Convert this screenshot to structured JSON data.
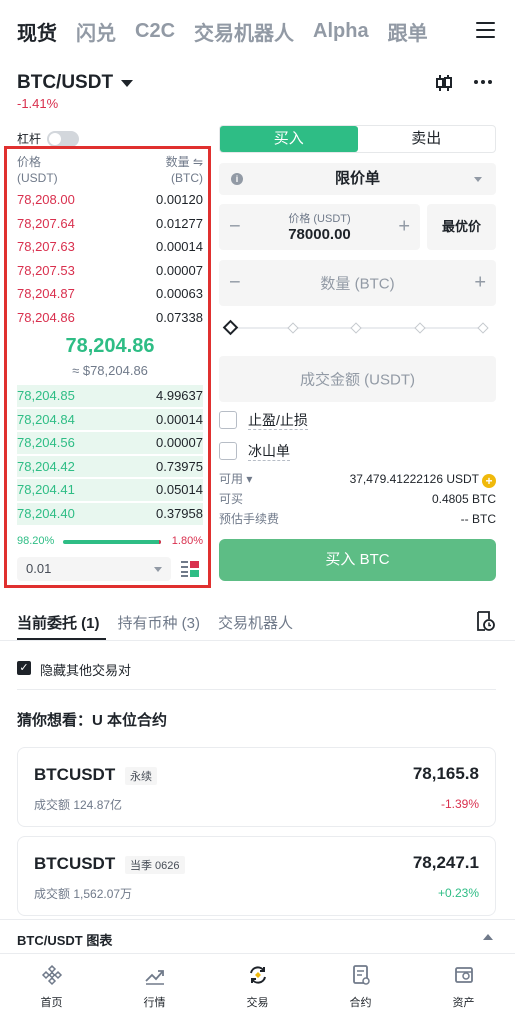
{
  "nav": {
    "tabs": [
      "现货",
      "闪兑",
      "C2C",
      "交易机器人",
      "Alpha",
      "跟单"
    ],
    "active": 0
  },
  "pair": {
    "symbol": "BTC/USDT",
    "change": "-1.41%"
  },
  "leverage_label": "杠杆",
  "orderbook": {
    "price_header": "价格",
    "price_unit": "(USDT)",
    "qty_header": "数量 ⇋",
    "qty_unit": "(BTC)",
    "asks": [
      {
        "price": "78,208.00",
        "qty": "0.00120"
      },
      {
        "price": "78,207.64",
        "qty": "0.01277"
      },
      {
        "price": "78,207.63",
        "qty": "0.00014"
      },
      {
        "price": "78,207.53",
        "qty": "0.00007"
      },
      {
        "price": "78,204.87",
        "qty": "0.00063"
      },
      {
        "price": "78,204.86",
        "qty": "0.07338"
      }
    ],
    "mid_price": "78,204.86",
    "mid_usd": "≈ $78,204.86",
    "bids": [
      {
        "price": "78,204.85",
        "qty": "4.99637"
      },
      {
        "price": "78,204.84",
        "qty": "0.00014"
      },
      {
        "price": "78,204.56",
        "qty": "0.00007"
      },
      {
        "price": "78,204.42",
        "qty": "0.73975"
      },
      {
        "price": "78,204.41",
        "qty": "0.05014"
      },
      {
        "price": "78,204.40",
        "qty": "0.37958"
      }
    ],
    "buy_ratio": "98.20%",
    "sell_ratio": "1.80%",
    "buy_ratio_value": 0.982,
    "precision": "0.01"
  },
  "order_form": {
    "buy_tab": "买入",
    "sell_tab": "卖出",
    "order_type": "限价单",
    "price_label": "价格 (USDT)",
    "price_value": "78000.00",
    "best_price": "最优价",
    "qty_placeholder": "数量 (BTC)",
    "total_placeholder": "成交金额 (USDT)",
    "tp_sl": "止盈/止损",
    "iceberg": "冰山单",
    "available_label": "可用 ▾",
    "available_value": "37,479.41222126 USDT",
    "can_buy_label": "可买",
    "can_buy_value": "0.4805 BTC",
    "fee_label": "预估手续费",
    "fee_value": "-- BTC",
    "buy_button": "买入 BTC"
  },
  "orders": {
    "tabs": [
      "当前委托 (1)",
      "持有币种 (3)",
      "交易机器人"
    ],
    "hide_other": "隐藏其他交易对",
    "guess_title": "猜你想看：U 本位合约",
    "cards": [
      {
        "symbol": "BTCUSDT",
        "tag": "永续",
        "volume": "成交额 124.87亿",
        "price": "78,165.8",
        "change": "-1.39%",
        "change_color": "#d9304e"
      },
      {
        "symbol": "BTCUSDT",
        "tag": "当季 0626",
        "volume": "成交额 1,562.07万",
        "price": "78,247.1",
        "change": "+0.23%",
        "change_color": "#2ebd85"
      }
    ]
  },
  "chart_bar": "BTC/USDT 图表",
  "bottom_nav": [
    "首页",
    "行情",
    "交易",
    "合约",
    "资产"
  ],
  "colors": {
    "buy": "#2ebd85",
    "sell": "#d9304e",
    "highlight_box": "#e0302f"
  }
}
